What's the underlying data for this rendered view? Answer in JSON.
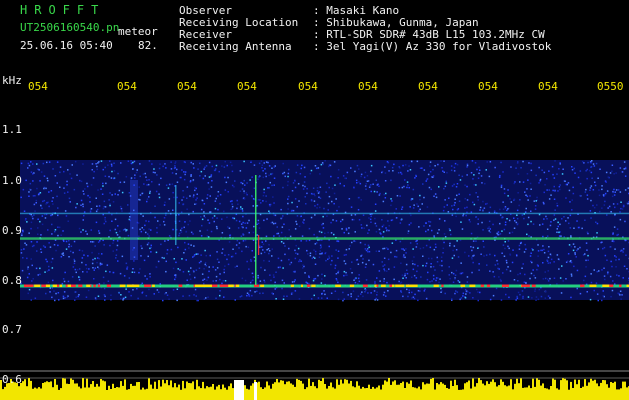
{
  "header": {
    "logo": "HROFFT",
    "filename": "UT2506160540.pn",
    "mode": "meteor",
    "datetime": "25.06.16 05:40",
    "count": "82."
  },
  "info": {
    "rows": [
      {
        "label": "Observer",
        "value": ": Masaki Kano"
      },
      {
        "label": "Receiving Location",
        "value": ": Shibukawa, Gunma, Japan"
      },
      {
        "label": "Receiver",
        "value": ": RTL-SDR SDR# 43dB L15 103.2MHz CW"
      },
      {
        "label": "Receiving Antenna",
        "value": ": 3el Yagi(V) Az 330 for Vladivostok"
      }
    ]
  },
  "axis": {
    "unit": "kHz",
    "y_ticks": [
      {
        "label": "1.1",
        "value": 1.1
      },
      {
        "label": "1.0",
        "value": 1.0
      },
      {
        "label": "0.9",
        "value": 0.9
      },
      {
        "label": "0.8",
        "value": 0.8
      },
      {
        "label": "0.7",
        "value": 0.7
      },
      {
        "label": "0.6",
        "value": 0.6
      }
    ],
    "x_ticks": [
      "054",
      "054",
      "054",
      "054",
      "054",
      "054",
      "054",
      "054",
      "054",
      "0550"
    ]
  },
  "colors": {
    "header_green": "#39d84a",
    "text_white": "#f2f2f2",
    "tick_yellow": "#f2e600",
    "noise_blue": "#1c2fd0",
    "band_green": "#3cff6a",
    "peak_red": "#ff3030"
  }
}
